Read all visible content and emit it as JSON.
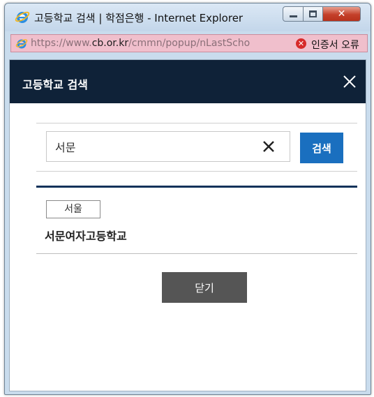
{
  "window": {
    "title": "고등학교 검색 | 학점은행 - Internet Explorer",
    "controls": {
      "minimize": "minimize-icon",
      "maximize": "maximize-icon",
      "close": "close-icon"
    }
  },
  "addressbar": {
    "url_prefix": "https://www.",
    "url_domain": "cb.or.kr",
    "url_path": "/cmmn/popup/nLastScho",
    "cert_warning": "인증서 오류"
  },
  "popup": {
    "title": "고등학교 검색",
    "search": {
      "value": "서문",
      "button_label": "검색"
    },
    "results": [
      {
        "region": "서울",
        "school": "서문여자고등학교"
      }
    ],
    "close_button_label": "닫기"
  },
  "colors": {
    "header_bg": "#0f2238",
    "search_button": "#1a6fbf",
    "results_rule": "#10325a",
    "close_button": "#555555",
    "addressbar_error": "#f0bfcc"
  }
}
